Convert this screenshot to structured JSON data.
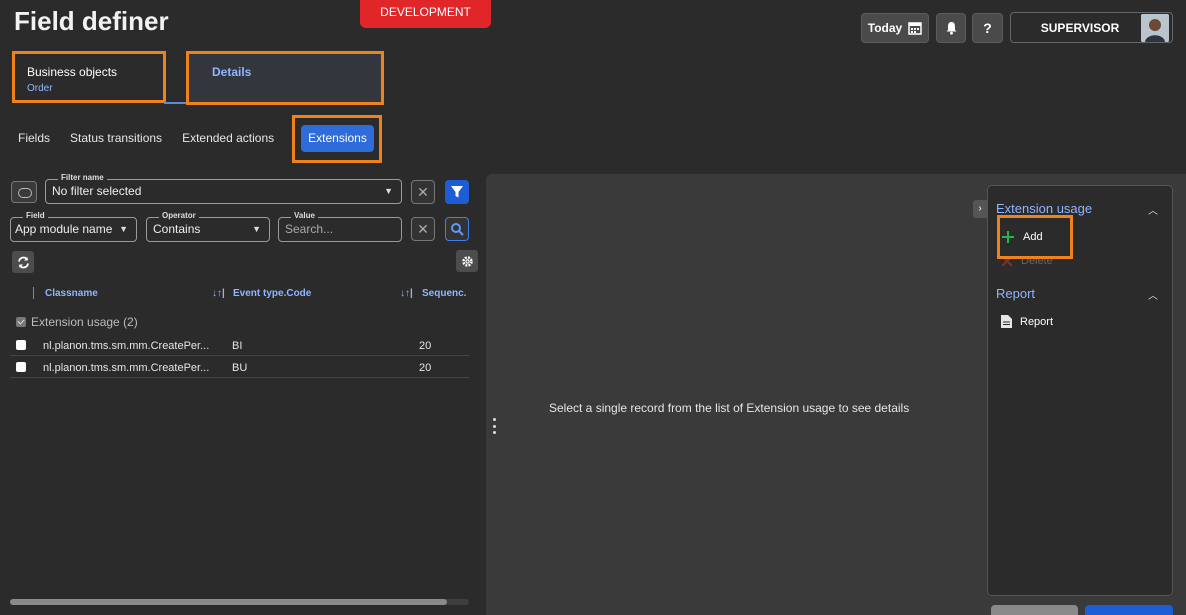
{
  "app": {
    "title": "Field definer",
    "environment": "DEVELOPMENT"
  },
  "header": {
    "today_label": "Today",
    "help_label": "?",
    "user_name": "SUPERVISOR"
  },
  "navigation": {
    "business_objects": {
      "label": "Business objects",
      "value": "Order"
    },
    "details_label": "Details"
  },
  "subtabs": [
    {
      "label": "Fields"
    },
    {
      "label": "Status transitions"
    },
    {
      "label": "Extended actions"
    },
    {
      "label": "Extensions",
      "active": true
    }
  ],
  "filter": {
    "filter_name_legend": "Filter name",
    "filter_name_value": "No filter selected",
    "field_legend": "Field",
    "field_value": "App module name",
    "operator_legend": "Operator",
    "operator_value": "Contains",
    "value_legend": "Value",
    "value_placeholder": "Search..."
  },
  "table": {
    "columns": [
      "Classname",
      "Event type.Code",
      "Sequenc."
    ],
    "group": {
      "label": "Extension usage (2)"
    },
    "rows": [
      {
        "classname": "nl.planon.tms.sm.mm.CreatePer...",
        "event": "BI",
        "sequence": "20"
      },
      {
        "classname": "nl.planon.tms.sm.mm.CreatePer...",
        "event": "BU",
        "sequence": "20"
      }
    ]
  },
  "detail": {
    "empty_message": "Select a single record from the list of Extension usage to see details"
  },
  "actions": {
    "section1_title": "Extension usage",
    "add_label": "Add",
    "delete_label": "Delete",
    "section2_title": "Report",
    "report_label": "Report"
  },
  "colors": {
    "accent": "#2f6bd9",
    "highlight": "#f0821e",
    "env": "#e1262a",
    "link": "#8fb6ff"
  }
}
